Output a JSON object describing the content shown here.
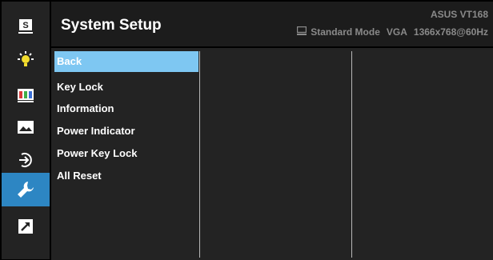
{
  "header": {
    "title": "System Setup",
    "model": "ASUS VT168",
    "mode": "Standard Mode",
    "input": "VGA",
    "resolution": "1366x768@60Hz"
  },
  "rail": {
    "items": [
      {
        "icon": "splendid-icon",
        "glyph": "S",
        "active": false
      },
      {
        "icon": "brightness-icon",
        "active": false
      },
      {
        "icon": "color-bars-icon",
        "active": false
      },
      {
        "icon": "image-icon",
        "active": false
      },
      {
        "icon": "input-select-icon",
        "active": false
      },
      {
        "icon": "system-setup-wrench-icon",
        "active": true
      },
      {
        "icon": "shortcut-arrow-icon",
        "active": false
      }
    ]
  },
  "menu": {
    "items": [
      {
        "label": "Back",
        "selected": true
      },
      {
        "label": "Key Lock",
        "selected": false
      },
      {
        "label": "Information",
        "selected": false
      },
      {
        "label": "Power Indicator",
        "selected": false
      },
      {
        "label": "Power Key Lock",
        "selected": false
      },
      {
        "label": "All Reset",
        "selected": false
      }
    ]
  },
  "colors": {
    "background": "#000000",
    "panel": "#232323",
    "header": "#1c1c1c",
    "active_icon_bg": "#2d86c3",
    "selected_item_bg": "#7ec7f2",
    "secondary_text": "#8a8a8a"
  }
}
